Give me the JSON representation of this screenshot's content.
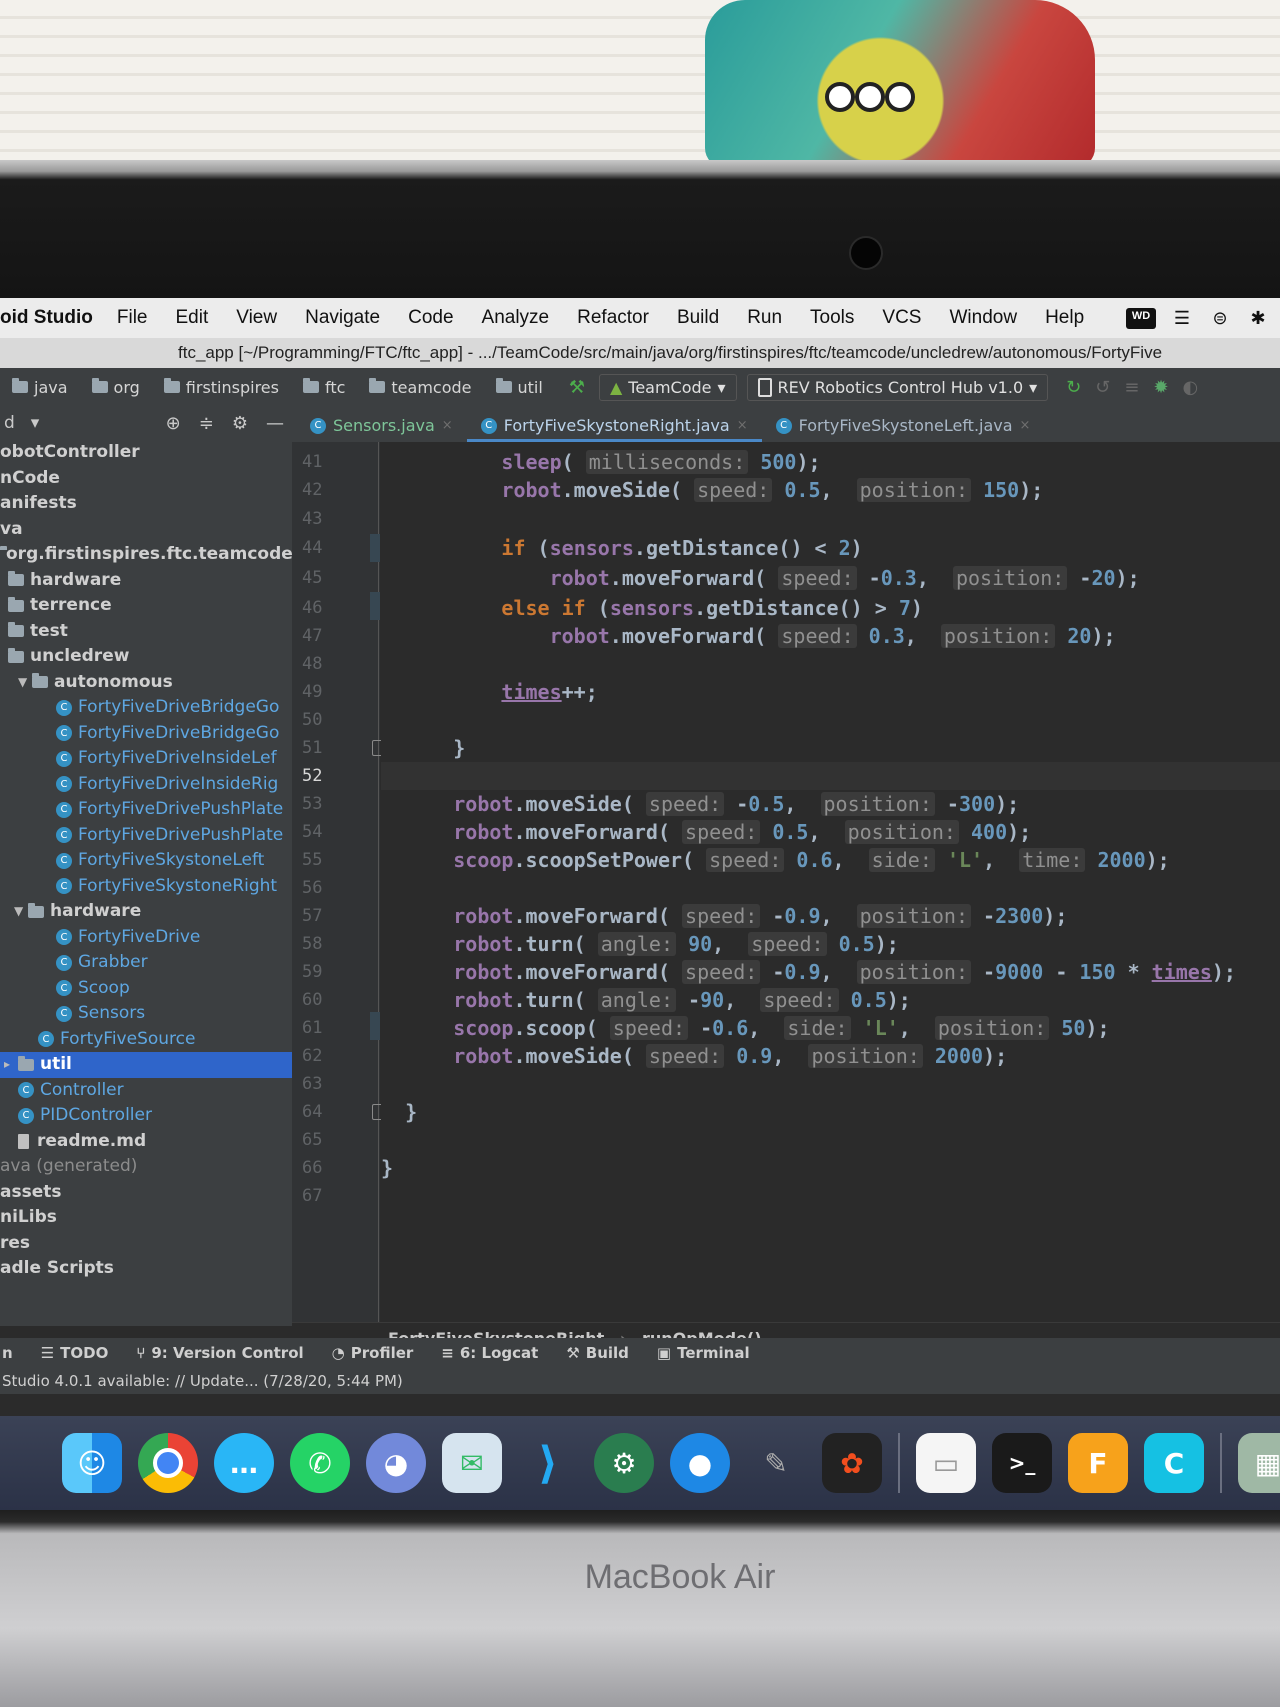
{
  "menubar": {
    "app_name": "oid Studio",
    "items": [
      "File",
      "Edit",
      "View",
      "Navigate",
      "Code",
      "Analyze",
      "Refactor",
      "Build",
      "Run",
      "Tools",
      "VCS",
      "Window",
      "Help"
    ],
    "status_icons": [
      "wd-icon",
      "drive-icon",
      "globe-icon",
      "bluetooth-icon"
    ],
    "status_wd": "WD",
    "status_bt": "✱"
  },
  "window_title": "ftc_app [~/Programming/FTC/ftc_app] - .../TeamCode/src/main/java/org/firstinspires/ftc/teamcode/uncledrew/autonomous/FortyFive",
  "navbar": {
    "crumbs": [
      "java",
      "org",
      "firstinspires",
      "ftc",
      "teamcode",
      "util"
    ],
    "run_config": "TeamCode",
    "device": "REV Robotics Control Hub v1.0"
  },
  "project_panel": {
    "header": "d",
    "tree": [
      {
        "label": "obotController",
        "type": "module"
      },
      {
        "label": "nCode",
        "type": "module"
      },
      {
        "label": "anifests",
        "type": "folder-text"
      },
      {
        "label": "va",
        "type": "folder-text"
      },
      {
        "label": "org.firstinspires.ftc.teamcode",
        "type": "package"
      },
      {
        "label": "hardware",
        "type": "folder"
      },
      {
        "label": "terrence",
        "type": "folder"
      },
      {
        "label": "test",
        "type": "folder"
      },
      {
        "label": "uncledrew",
        "type": "folder"
      },
      {
        "label": "autonomous",
        "type": "folder-open"
      },
      {
        "label": "FortyFiveDriveBridgeGo",
        "type": "class"
      },
      {
        "label": "FortyFiveDriveBridgeGo",
        "type": "class"
      },
      {
        "label": "FortyFiveDriveInsideLef",
        "type": "class"
      },
      {
        "label": "FortyFiveDriveInsideRig",
        "type": "class"
      },
      {
        "label": "FortyFiveDrivePushPlate",
        "type": "class"
      },
      {
        "label": "FortyFiveDrivePushPlate",
        "type": "class"
      },
      {
        "label": "FortyFiveSkystoneLeft",
        "type": "class"
      },
      {
        "label": "FortyFiveSkystoneRight",
        "type": "class"
      },
      {
        "label": "hardware",
        "type": "folder-open"
      },
      {
        "label": "FortyFiveDrive",
        "type": "class"
      },
      {
        "label": "Grabber",
        "type": "class"
      },
      {
        "label": "Scoop",
        "type": "class"
      },
      {
        "label": "Sensors",
        "type": "class"
      },
      {
        "label": "FortyFiveSource",
        "type": "class"
      },
      {
        "label": "util",
        "type": "folder-selected"
      },
      {
        "label": "Controller",
        "type": "class"
      },
      {
        "label": "PIDController",
        "type": "class"
      },
      {
        "label": "readme.md",
        "type": "file"
      },
      {
        "label": "ava (generated)",
        "type": "generated"
      },
      {
        "label": "assets",
        "type": "folder-text"
      },
      {
        "label": "niLibs",
        "type": "folder-text"
      },
      {
        "label": "res",
        "type": "folder-text"
      },
      {
        "label": "adle Scripts",
        "type": "folder-text"
      }
    ]
  },
  "tabs": [
    {
      "label": "Sensors.java",
      "active": false
    },
    {
      "label": "FortyFiveSkystoneRight.java",
      "active": true
    },
    {
      "label": "FortyFiveSkystoneLeft.java",
      "active": false
    }
  ],
  "line_numbers": [
    "41",
    "42",
    "43",
    "44",
    "45",
    "46",
    "47",
    "48",
    "49",
    "50",
    "51",
    "52",
    "53",
    "54",
    "55",
    "56",
    "57",
    "58",
    "59",
    "60",
    "61",
    "62",
    "63",
    "64",
    "65",
    "66",
    "67"
  ],
  "current_line": "52",
  "editor_breadcrumb": {
    "class": "FortyFiveSkystoneRight",
    "method": "runOpMode()"
  },
  "bottom_tools": [
    {
      "label": "n"
    },
    {
      "label": "TODO"
    },
    {
      "label": "9: Version Control"
    },
    {
      "label": "Profiler"
    },
    {
      "label": "6: Logcat"
    },
    {
      "label": "Build"
    },
    {
      "label": "Terminal"
    }
  ],
  "status_message": "Studio 4.0.1 available: // Update... (7/28/20, 5:44 PM)",
  "dock_apps": [
    "Finder",
    "Chrome",
    "Messages",
    "WhatsApp",
    "Discord",
    "Preview",
    "VS Code",
    "Android Studio",
    "Maps",
    "GIMP",
    "Figma",
    "Notes",
    "Terminal",
    "Fusion 360",
    "Cinema"
  ],
  "laptop_brand": "MacBook Air",
  "colors": {
    "accent": "#4a88c7",
    "selection": "#2f65ca",
    "keyword": "#cc7832",
    "field": "#9876aa",
    "number": "#6897bb"
  }
}
